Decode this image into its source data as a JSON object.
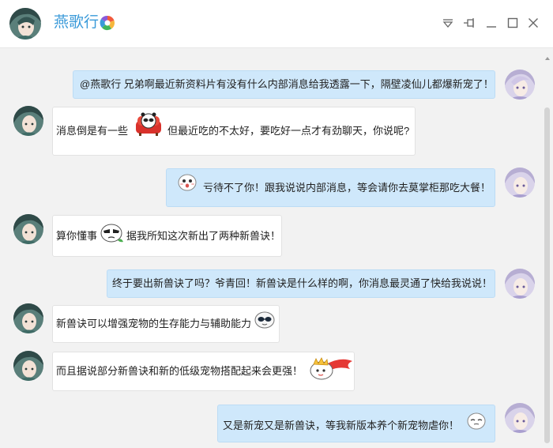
{
  "window": {
    "title": "燕歌行"
  },
  "titlebar": {
    "icons": [
      "logo-icon",
      "dropdown-icon",
      "pin-icon",
      "minimize-icon",
      "maximize-icon",
      "close-icon"
    ]
  },
  "messages": [
    {
      "direction": "out",
      "parts": [
        "@燕歌行 兄弟啊最近新资料片有没有什么内部消息给我透露一下，隔壁凌仙儿都爆新宠了！"
      ]
    },
    {
      "direction": "in",
      "parts": [
        "消息倒是有一些",
        "但最近吃的不太好，要吃好一点才有劲聊天，你说呢?"
      ],
      "sticker": "panda-couch-sticker"
    },
    {
      "direction": "out",
      "parts": [
        "亏待不了你！跟我说说内部消息，等会请你去莫掌柜那吃大餐！"
      ],
      "sticker": "scared-face-sticker"
    },
    {
      "direction": "in",
      "parts": [
        "算你懂事",
        "据我所知这次新出了两种新兽诀！"
      ],
      "sticker": "cool-dumpling-sticker"
    },
    {
      "direction": "out",
      "parts": [
        "终于要出新兽诀了吗？爷青回！新兽诀是什么样的啊，你消息最灵通了快给我说说！"
      ]
    },
    {
      "direction": "in",
      "parts": [
        "新兽诀可以增强宠物的生存能力与辅助能力"
      ],
      "sticker": "sunglasses-face-sticker"
    },
    {
      "direction": "in",
      "parts": [
        "而且据说部分新兽诀和新的低级宠物搭配起来会更强！"
      ],
      "sticker": "flying-hero-sticker"
    },
    {
      "direction": "out",
      "parts": [
        "又是新宠又是新兽诀，等我新版本养个新宠物虐你！"
      ],
      "sticker": "sleepy-face-sticker"
    }
  ],
  "colors": {
    "title": "#3a9ad9",
    "chat_bg": "#f2f2f2",
    "bubble_out": "#cfe8fb",
    "bubble_in": "#ffffff"
  }
}
